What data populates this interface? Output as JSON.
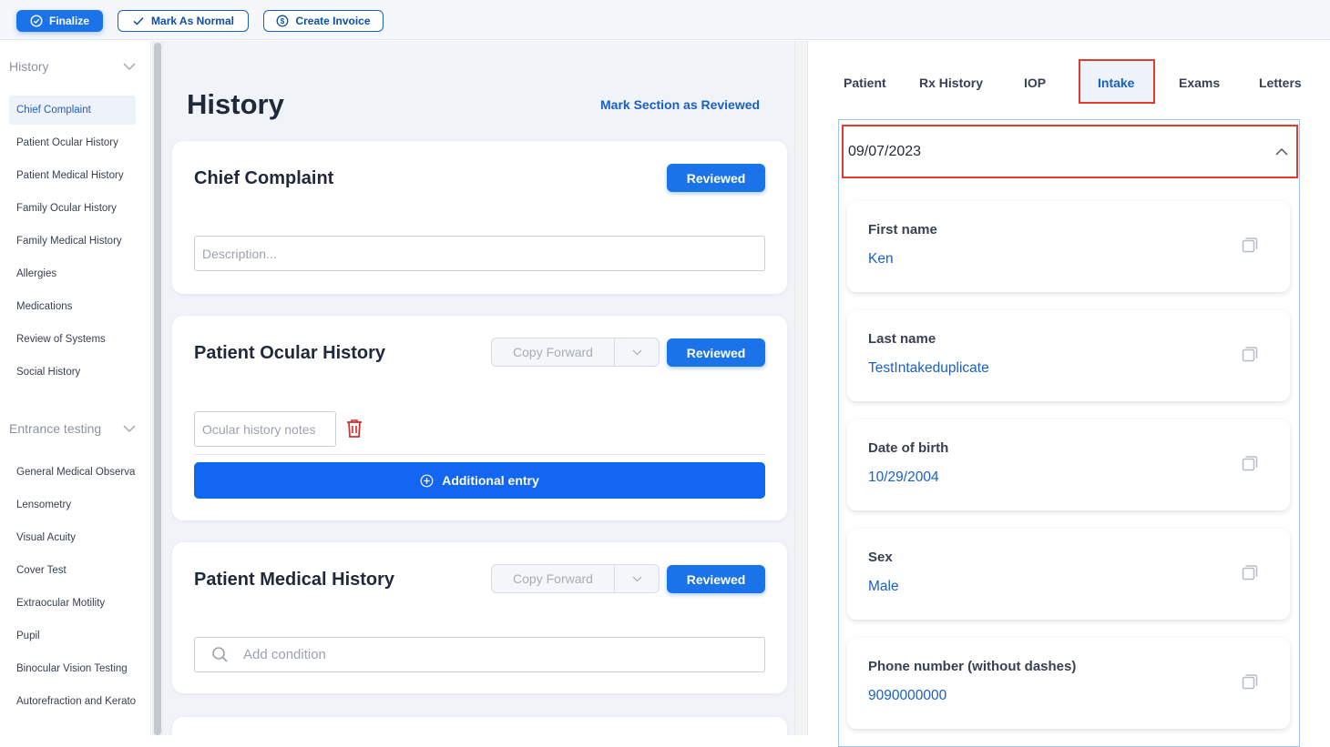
{
  "toolbar": {
    "finalize_label": "Finalize",
    "mark_normal_label": "Mark As Normal",
    "create_invoice_label": "Create Invoice"
  },
  "leftnav": {
    "history_section": {
      "label": "History",
      "items": [
        {
          "label": "Chief Complaint",
          "active": true
        },
        {
          "label": "Patient Ocular History"
        },
        {
          "label": "Patient Medical History"
        },
        {
          "label": "Family Ocular History"
        },
        {
          "label": "Family Medical History"
        },
        {
          "label": "Allergies"
        },
        {
          "label": "Medications"
        },
        {
          "label": "Review of Systems"
        },
        {
          "label": "Social History"
        }
      ]
    },
    "entrance_section": {
      "label": "Entrance testing",
      "items": [
        {
          "label": "General Medical Observation"
        },
        {
          "label": "Lensometry"
        },
        {
          "label": "Visual Acuity"
        },
        {
          "label": "Cover Test"
        },
        {
          "label": "Extraocular Motility"
        },
        {
          "label": "Pupil"
        },
        {
          "label": "Binocular Vision Testing"
        },
        {
          "label": "Autorefraction and Keratometry"
        }
      ]
    }
  },
  "main": {
    "title": "History",
    "mark_section_reviewed": "Mark Section as Reviewed",
    "chief_complaint": {
      "title": "Chief Complaint",
      "reviewed_label": "Reviewed",
      "description_placeholder": "Description..."
    },
    "patient_ocular_history": {
      "title": "Patient Ocular History",
      "copy_forward_label": "Copy Forward",
      "reviewed_label": "Reviewed",
      "notes_placeholder": "Ocular history notes",
      "additional_entry_label": "Additional entry"
    },
    "patient_medical_history": {
      "title": "Patient Medical History",
      "copy_forward_label": "Copy Forward",
      "reviewed_label": "Reviewed",
      "condition_placeholder": "Add condition"
    }
  },
  "right_panel": {
    "tabs": [
      {
        "label": "Patient"
      },
      {
        "label": "Rx History"
      },
      {
        "label": "IOP"
      },
      {
        "label": "Intake",
        "active": true
      },
      {
        "label": "Exams"
      },
      {
        "label": "Letters"
      }
    ],
    "intake_date": "09/07/2023",
    "fields": [
      {
        "label": "First name",
        "value": "Ken"
      },
      {
        "label": "Last name",
        "value": "TestIntakeduplicate"
      },
      {
        "label": "Date of birth",
        "value": "10/29/2004"
      },
      {
        "label": "Sex",
        "value": "Male"
      },
      {
        "label": "Phone number (without dashes)",
        "value": "9090000000"
      }
    ]
  },
  "colors": {
    "primary": "#1a73e8",
    "link": "#1a5fc4",
    "highlight_border": "#e33b2e",
    "delete": "#d32f2f"
  }
}
